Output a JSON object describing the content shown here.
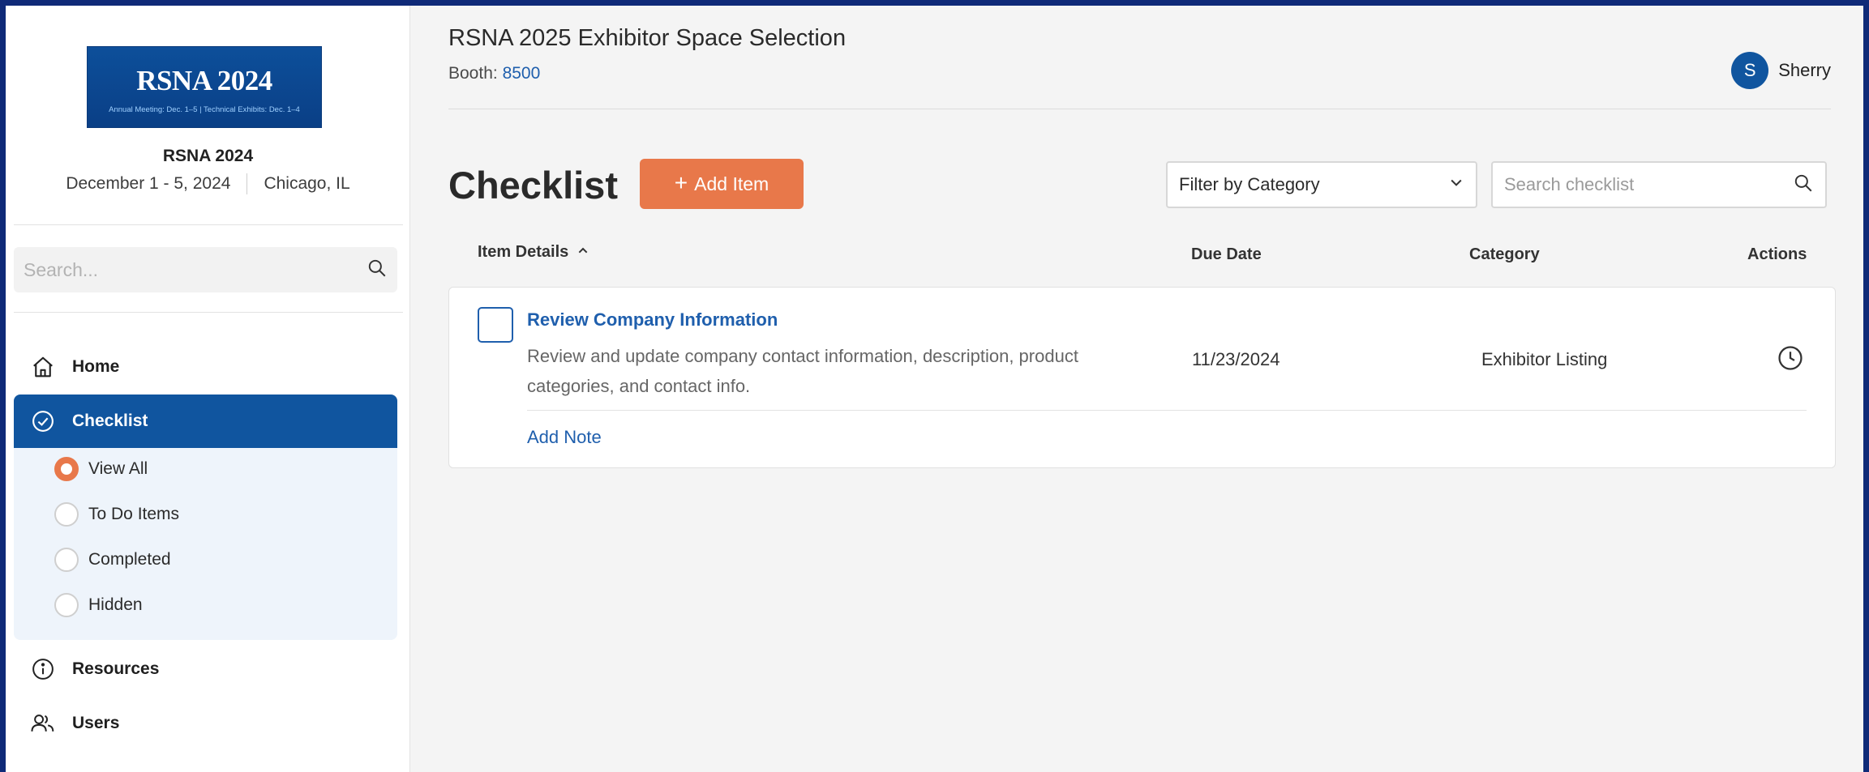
{
  "sidebar": {
    "logo": {
      "title": "RSNA 2024",
      "subtitle": "Annual Meeting: Dec. 1–5  |  Technical Exhibits: Dec. 1–4"
    },
    "event_name": "RSNA 2024",
    "event_dates": "December 1 - 5, 2024",
    "event_location": "Chicago, IL",
    "search_placeholder": "Search...",
    "nav": {
      "home": "Home",
      "checklist": "Checklist",
      "resources": "Resources",
      "users": "Users"
    },
    "submenu": [
      {
        "label": "View All",
        "selected": true
      },
      {
        "label": "To Do Items",
        "selected": false
      },
      {
        "label": "Completed",
        "selected": false
      },
      {
        "label": "Hidden",
        "selected": false
      }
    ]
  },
  "header": {
    "title": "RSNA 2025 Exhibitor Space Selection",
    "booth_label": "Booth:",
    "booth_number": "8500",
    "user": {
      "initial": "S",
      "name": "Sherry"
    }
  },
  "toolbar": {
    "heading": "Checklist",
    "add_label": "Add Item",
    "filter_label": "Filter by Category",
    "search_placeholder": "Search checklist"
  },
  "table": {
    "columns": {
      "details": "Item Details",
      "due_date": "Due Date",
      "category": "Category",
      "actions": "Actions"
    },
    "rows": [
      {
        "title": "Review Company Information",
        "description": "Review and update company contact information, description, product categories, and contact info.",
        "due_date": "11/23/2024",
        "category": "Exhibitor Listing",
        "note_label": "Add Note"
      }
    ]
  },
  "colors": {
    "primary": "#10559f",
    "accent": "#e8784a",
    "link": "#1f5fad",
    "page_bg": "#f4f4f4",
    "outer_bg": "#0f2a78"
  },
  "icons": [
    "search-icon",
    "home-icon",
    "check-circle-icon",
    "info-icon",
    "users-icon",
    "plus-icon",
    "chevron-down-icon",
    "sort-up-icon",
    "clock-icon"
  ]
}
